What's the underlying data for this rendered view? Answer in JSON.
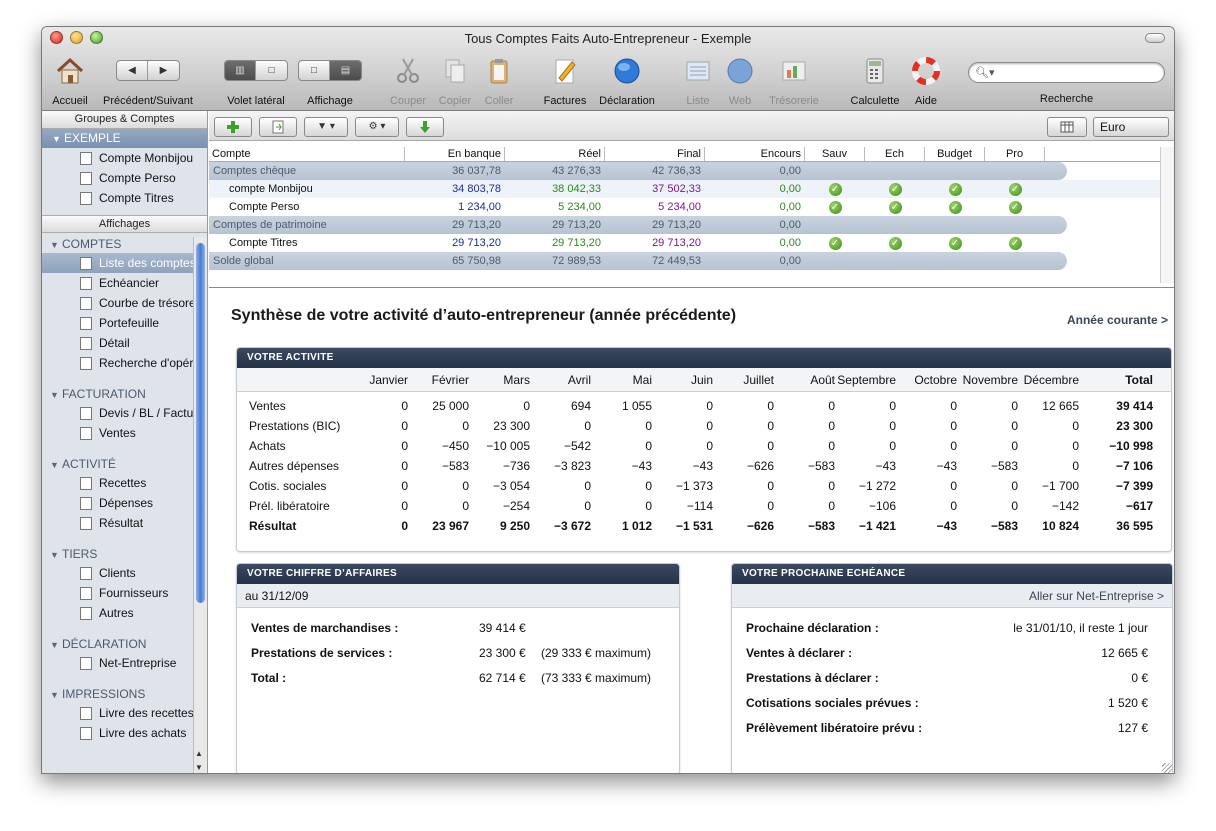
{
  "window": {
    "title": "Tous Comptes Faits Auto-Entrepreneur - Exemple"
  },
  "toolbar": {
    "accueil": "Accueil",
    "precsuiv": "Précédent/Suivant",
    "volet": "Volet latéral",
    "affichage": "Affichage",
    "couper": "Couper",
    "copier": "Copier",
    "coller": "Coller",
    "factures": "Factures",
    "declaration": "Déclaration",
    "liste": "Liste",
    "web": "Web",
    "tresorerie": "Trésorerie",
    "calculette": "Calculette",
    "aide": "Aide",
    "recherche": "Recherche"
  },
  "sidebar": {
    "groupes_header": "Groupes & Comptes",
    "exemple": "EXEMPLE",
    "accounts": [
      "Compte Monbijou",
      "Compte Perso",
      "Compte Titres"
    ],
    "affichages_header": "Affichages",
    "groups": [
      {
        "title": "COMPTES",
        "items": [
          "Liste des comptes",
          "Echéancier",
          "Courbe de trésorerie",
          "Portefeuille",
          "Détail",
          "Recherche d'opérations"
        ]
      },
      {
        "title": "FACTURATION",
        "items": [
          "Devis / BL / Factures",
          "Ventes"
        ]
      },
      {
        "title": "ACTIVITÉ",
        "items": [
          "Recettes",
          "Dépenses",
          "Résultat"
        ]
      },
      {
        "title": "TIERS",
        "items": [
          "Clients",
          "Fournisseurs",
          "Autres"
        ]
      },
      {
        "title": "DÉCLARATION",
        "items": [
          "Net-Entreprise"
        ]
      },
      {
        "title": "IMPRESSIONS",
        "items": [
          "Livre des recettes",
          "Livre des achats"
        ]
      }
    ]
  },
  "main_toolbar": {
    "currency": "Euro"
  },
  "accounts_table": {
    "headers": [
      "Compte",
      "En banque",
      "Réel",
      "Final",
      "Encours",
      "Sauv",
      "Ech",
      "Budget",
      "Pro"
    ],
    "rows": [
      {
        "type": "group",
        "name": "Comptes chèque",
        "en_banque": "36 037,78",
        "reel": "43 276,33",
        "final": "42 736,33",
        "encours": "0,00"
      },
      {
        "type": "account",
        "name": "compte Monbijou",
        "en_banque": "34 803,78",
        "reel": "38 042,33",
        "final": "37 502,33",
        "encours": "0,00"
      },
      {
        "type": "account",
        "name": "Compte Perso",
        "en_banque": "1 234,00",
        "reel": "5 234,00",
        "final": "5 234,00",
        "encours": "0,00"
      },
      {
        "type": "group",
        "name": "Comptes de patrimoine",
        "en_banque": "29 713,20",
        "reel": "29 713,20",
        "final": "29 713,20",
        "encours": "0,00"
      },
      {
        "type": "account",
        "name": "Compte Titres",
        "en_banque": "29 713,20",
        "reel": "29 713,20",
        "final": "29 713,20",
        "encours": "0,00"
      },
      {
        "type": "group",
        "name": "Solde global",
        "en_banque": "65 750,98",
        "reel": "72 989,53",
        "final": "72 449,53",
        "encours": "0,00"
      }
    ]
  },
  "synthese": {
    "title": "Synthèse de votre activité d’auto-entrepreneur (année précédente)",
    "annee_link": "Année courante  >"
  },
  "activite": {
    "header": "VOTRE ACTIVITE",
    "months": [
      "Janvier",
      "Février",
      "Mars",
      "Avril",
      "Mai",
      "Juin",
      "Juillet",
      "Août",
      "Septembre",
      "Octobre",
      "Novembre",
      "Décembre"
    ],
    "total_label": "Total",
    "rows": [
      {
        "label": "Ventes",
        "values": [
          "0",
          "25 000",
          "0",
          "694",
          "1 055",
          "0",
          "0",
          "0",
          "0",
          "0",
          "0",
          "12 665"
        ],
        "total": "39 414"
      },
      {
        "label": "Prestations (BIC)",
        "values": [
          "0",
          "0",
          "23 300",
          "0",
          "0",
          "0",
          "0",
          "0",
          "0",
          "0",
          "0",
          "0"
        ],
        "total": "23 300"
      },
      {
        "label": "Achats",
        "values": [
          "0",
          "−450",
          "−10 005",
          "−542",
          "0",
          "0",
          "0",
          "0",
          "0",
          "0",
          "0",
          "0"
        ],
        "total": "−10 998"
      },
      {
        "label": "Autres dépenses",
        "values": [
          "0",
          "−583",
          "−736",
          "−3 823",
          "−43",
          "−43",
          "−626",
          "−583",
          "−43",
          "−43",
          "−583",
          "0"
        ],
        "total": "−7 106"
      },
      {
        "label": "Cotis. sociales",
        "values": [
          "0",
          "0",
          "−3 054",
          "0",
          "0",
          "−1 373",
          "0",
          "0",
          "−1 272",
          "0",
          "0",
          "−1 700"
        ],
        "total": "−7 399"
      },
      {
        "label": "Prél. libératoire",
        "values": [
          "0",
          "0",
          "−254",
          "0",
          "0",
          "−114",
          "0",
          "0",
          "−106",
          "0",
          "0",
          "−142"
        ],
        "total": "−617"
      },
      {
        "label": "Résultat",
        "values": [
          "0",
          "23 967",
          "9 250",
          "−3 672",
          "1 012",
          "−1 531",
          "−626",
          "−583",
          "−1 421",
          "−43",
          "−583",
          "10 824"
        ],
        "total": "36 595",
        "bold": true
      }
    ]
  },
  "ca": {
    "header": "VOTRE CHIFFRE D’AFFAIRES",
    "date": "au 31/12/09",
    "rows": [
      {
        "k": "Ventes de marchandises :",
        "v": "39 414 €",
        "extra": ""
      },
      {
        "k": "Prestations de services :",
        "v": "23 300 €",
        "extra": "(29 333 € maximum)"
      },
      {
        "k": "Total :",
        "v": "62 714 €",
        "extra": "(73 333 € maximum)"
      }
    ]
  },
  "echeance": {
    "header": "VOTRE PROCHAINE ECHÉANCE",
    "link": "Aller sur Net-Entreprise  >",
    "rows": [
      {
        "k": "Prochaine déclaration :",
        "v": "le 31/01/10, il reste 1 jour"
      },
      {
        "k": "Ventes à déclarer :",
        "v": "12 665 €"
      },
      {
        "k": "Prestations à déclarer :",
        "v": "0 €"
      },
      {
        "k": "Cotisations sociales prévues :",
        "v": "1 520 €"
      },
      {
        "k": "Prélèvement libératoire prévu :",
        "v": "127 €"
      }
    ]
  },
  "colors": {
    "blue": "#1a2e9a",
    "green": "#2a8a1a",
    "purple": "#7a1a8a",
    "header_navy": "#2b384f"
  }
}
